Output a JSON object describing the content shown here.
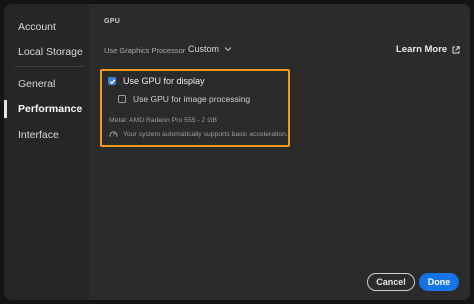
{
  "sidebar": {
    "items": [
      {
        "id": "account",
        "label": "Account",
        "active": false
      },
      {
        "id": "local-storage",
        "label": "Local Storage",
        "active": false
      },
      {
        "id": "general",
        "label": "General",
        "active": false
      },
      {
        "id": "performance",
        "label": "Performance",
        "active": true
      },
      {
        "id": "interface",
        "label": "Interface",
        "active": false
      }
    ]
  },
  "main": {
    "section_title": "GPU",
    "graphics_processor": {
      "label": "Use Graphics Processor",
      "value": "Custom"
    },
    "learn_more_label": "Learn More",
    "gpu_display": {
      "label": "Use GPU for display",
      "checked": true
    },
    "gpu_image": {
      "label": "Use GPU for image processing",
      "checked": false
    },
    "metal_info": "Metal: AMD Radeon Pro 555 - 2 GB",
    "acceleration_note": "Your system automatically supports basic acceleration."
  },
  "footer": {
    "cancel_label": "Cancel",
    "done_label": "Done"
  },
  "colors": {
    "highlight_box": "#f49a1f",
    "primary_button": "#1473e6",
    "checkbox_on": "#3a7fe0"
  }
}
